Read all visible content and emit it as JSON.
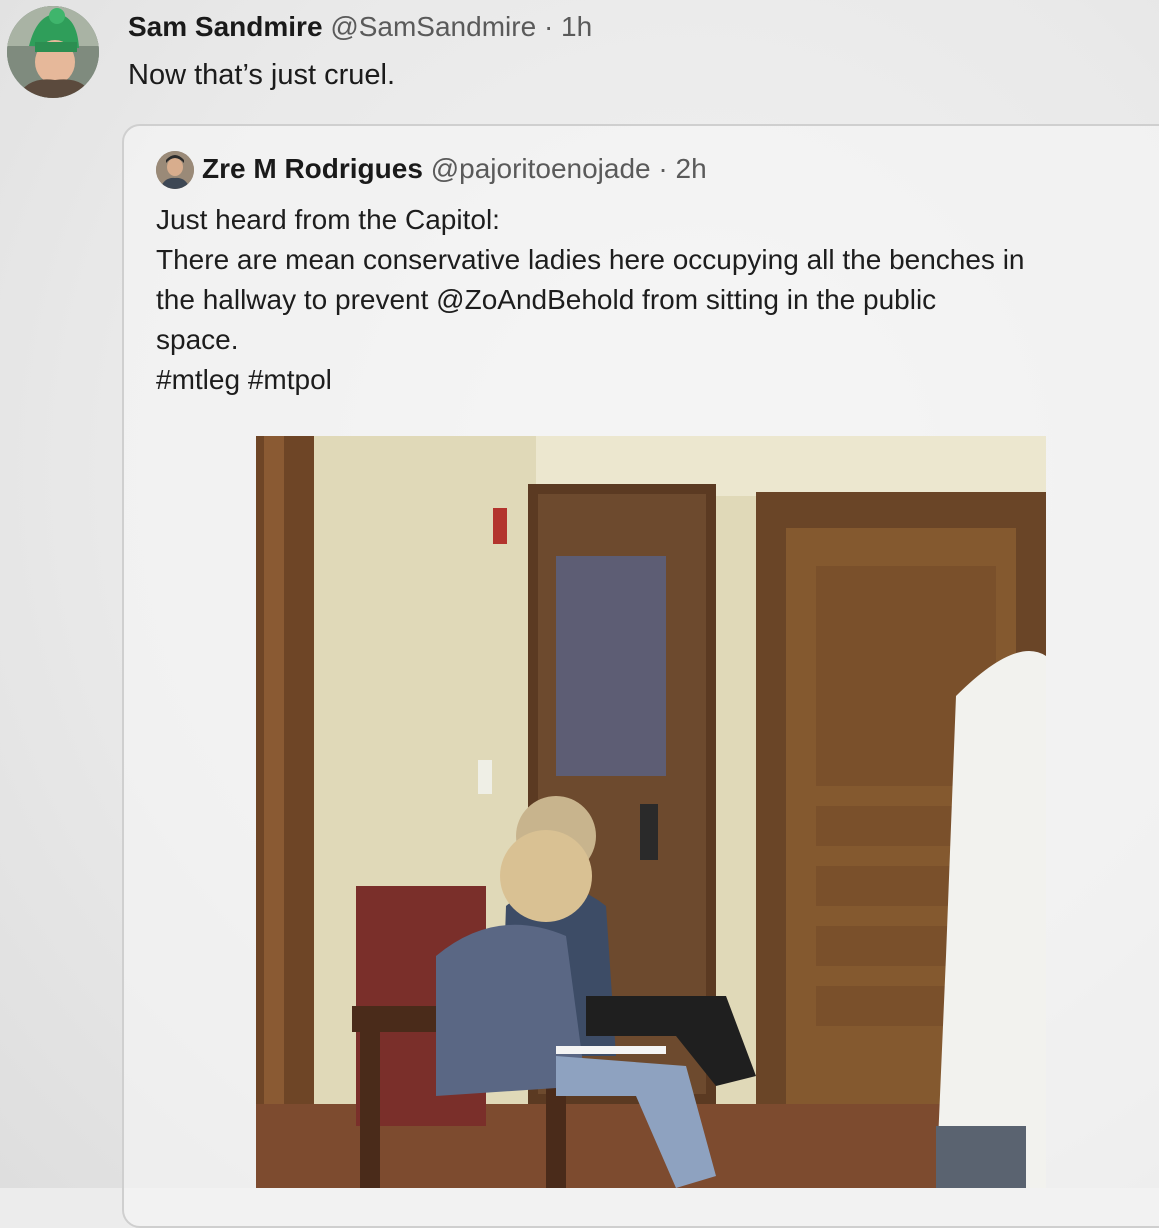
{
  "tweet": {
    "display_name": "Sam Sandmire",
    "handle": "@SamSandmire",
    "separator": "·",
    "time": "1h",
    "text": "Now that’s just cruel."
  },
  "quoted_tweet": {
    "display_name": "Zre M Rodrigues",
    "handle": "@pajoritoenojade",
    "separator": "·",
    "time": "2h",
    "lines": [
      "Just heard from the Capitol:",
      "There are mean conservative ladies here occupying all the benches in",
      "the hallway to prevent @ZoAndBehold from sitting in the public",
      "space.",
      "#mtleg #mtpol"
    ]
  }
}
